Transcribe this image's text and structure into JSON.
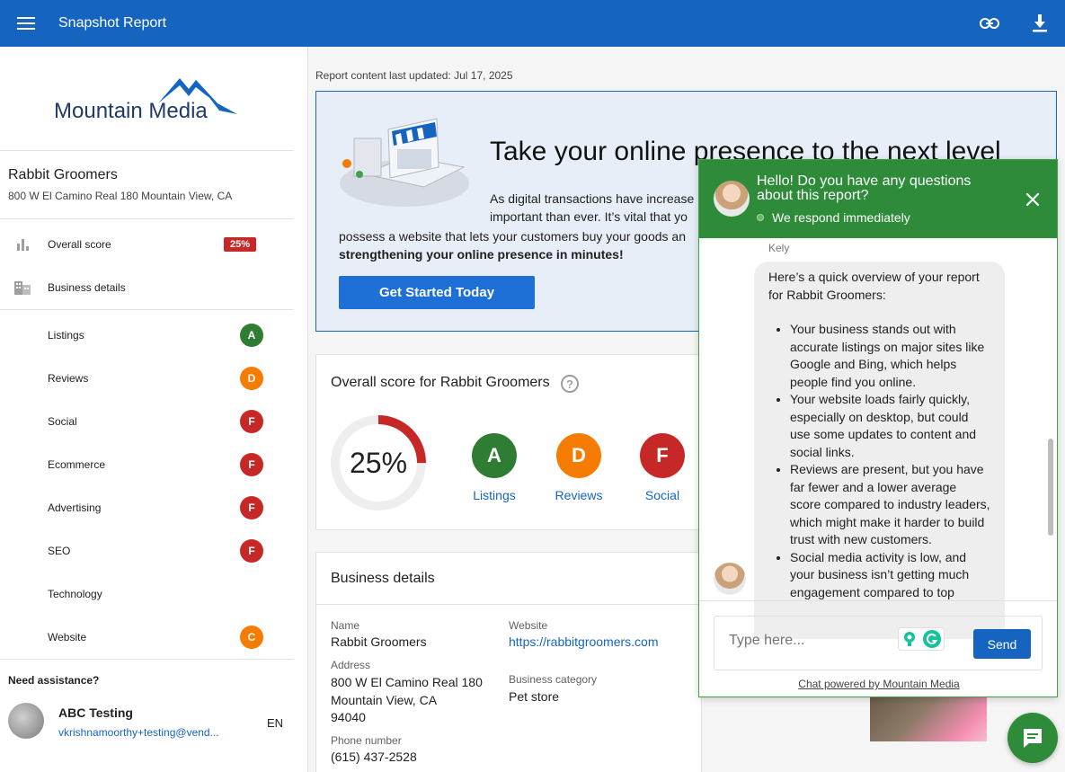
{
  "header": {
    "title": "Snapshot Report"
  },
  "sidebar": {
    "logo_text": "Mountain Media",
    "business_name": "Rabbit Groomers",
    "business_address": "800 W El Camino Real 180 Mountain View, CA",
    "overall": {
      "label": "Overall score",
      "score": "25%"
    },
    "business_details_label": "Business details",
    "sections": [
      {
        "label": "Listings",
        "grade": "A"
      },
      {
        "label": "Reviews",
        "grade": "D"
      },
      {
        "label": "Social",
        "grade": "F"
      },
      {
        "label": "Ecommerce",
        "grade": "F"
      },
      {
        "label": "Advertising",
        "grade": "F"
      },
      {
        "label": "SEO",
        "grade": "F"
      },
      {
        "label": "Technology",
        "grade": ""
      },
      {
        "label": "Website",
        "grade": "C"
      }
    ],
    "assistance_title": "Need assistance?",
    "contact_name": "ABC Testing",
    "contact_email": "vkrishnamoorthy+testing@vend...",
    "language": "EN"
  },
  "main": {
    "updated_label": "Report content last updated:",
    "updated_date": "Jul 17, 2025",
    "promo": {
      "heading": "Take your online presence to the next level",
      "line1": "As digital transactions have increase",
      "line2": "important than ever. It’s vital that yo",
      "line3": "possess a website that lets your customers buy your goods an",
      "line4": "strengthening your online presence in minutes!",
      "button": "Get Started Today"
    },
    "score_card": {
      "title": "Overall score for Rabbit Groomers",
      "score_text": "25%",
      "score_value": 25,
      "grades": [
        {
          "grade": "A",
          "label": "Listings"
        },
        {
          "grade": "D",
          "label": "Reviews"
        },
        {
          "grade": "F",
          "label": "Social"
        }
      ]
    },
    "details_card": {
      "title": "Business details",
      "name_label": "Name",
      "name_value": "Rabbit Groomers",
      "address_label": "Address",
      "address_line1": "800 W El Camino Real 180",
      "address_line2": "Mountain View, CA",
      "address_line3": "94040",
      "phone_label": "Phone number",
      "phone_value": "(615) 437-2528",
      "website_label": "Website",
      "website_value": "https://rabbitgroomers.com",
      "category_label": "Business category",
      "category_value": "Pet store"
    }
  },
  "chat": {
    "greeting": "Hello! Do you have any questions about this report?",
    "status": "We respond immediately",
    "sender": "Kely",
    "intro": "Here’s a quick overview of your report for Rabbit Groomers:",
    "bullets": [
      "Your business stands out with accurate listings on major sites like Google and Bing, which helps people find you online.",
      "Your website loads fairly quickly, especially on desktop, but could use some updates to content and social links.",
      "Reviews are present, but you have far fewer and a lower average score compared to industry leaders, which might make it harder to build trust with new customers.",
      "Social media activity is low, and your business isn’t getting much engagement compared to top"
    ],
    "input_placeholder": "Type here...",
    "send_label": "Send",
    "powered_by": "Chat powered by Mountain Media"
  },
  "colors": {
    "primary": "#1565c0",
    "chat_green": "#2e8b3a",
    "grade_a": "#2e7d32",
    "grade_d": "#f57c00",
    "grade_f": "#c62828"
  }
}
